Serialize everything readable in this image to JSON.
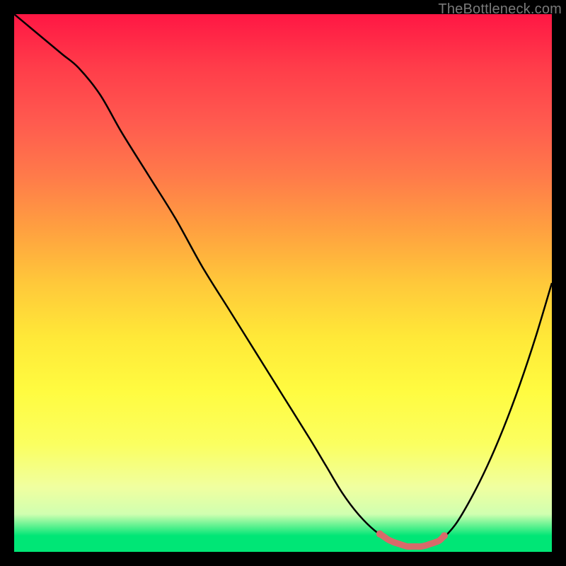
{
  "watermark": "TheBottleneck.com",
  "colors": {
    "curve": "#000000",
    "highlight": "#d86a6a",
    "frame": "#000000"
  },
  "chart_data": {
    "type": "line",
    "title": "",
    "xlabel": "",
    "ylabel": "",
    "xlim": [
      0,
      100
    ],
    "ylim": [
      0,
      100
    ],
    "series": [
      {
        "name": "bottleneck-curve",
        "x": [
          0,
          3,
          6,
          9,
          12,
          16,
          20,
          25,
          30,
          35,
          40,
          45,
          50,
          55,
          58,
          61,
          64,
          67,
          70,
          73,
          76,
          79,
          82,
          85,
          88,
          91,
          94,
          97,
          100
        ],
        "y": [
          100,
          97.5,
          95,
          92.5,
          90,
          85,
          78,
          70,
          62,
          53,
          45,
          37,
          29,
          21,
          16,
          11,
          7,
          4,
          2,
          1,
          1,
          2,
          5,
          10,
          16,
          23,
          31,
          40,
          50
        ]
      }
    ],
    "highlight_region": {
      "x_start": 68,
      "x_end": 80
    }
  }
}
